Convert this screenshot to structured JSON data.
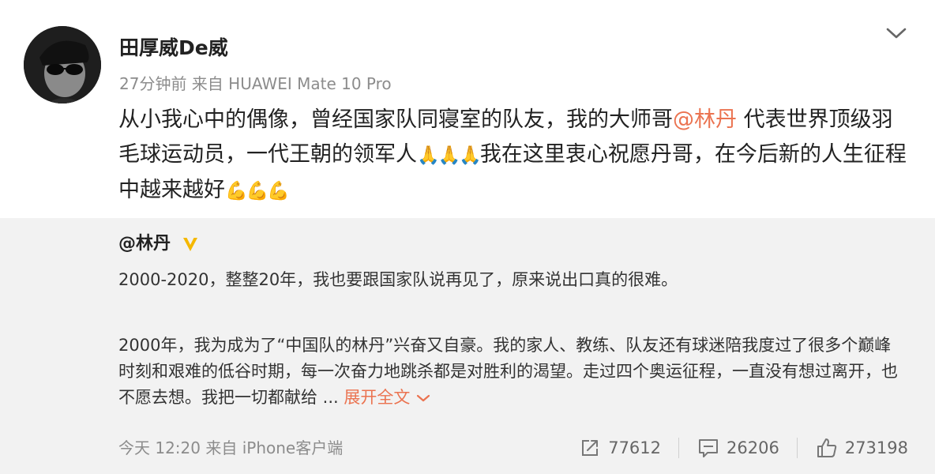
{
  "post": {
    "author": "田厚威De威",
    "meta": "27分钟前 来自 HUAWEI Mate 10 Pro",
    "text_part1": "从小我心中的偶像，曾经国家队同寝室的队友，我的大师哥",
    "mention": "@林丹",
    "text_part2": " 代表世界顶级羽毛球运动员，一代王朝的领军人",
    "emoji1": "🙏🙏🙏",
    "text_part3": "我在这里衷心祝愿丹哥，在今后新的人生征程中越来越好",
    "emoji2": "💪💪💪"
  },
  "repost": {
    "author": "@林丹",
    "paragraph1": "2000-2020，整整20年，我也要跟国家队说再见了，原来说出口真的很难。",
    "paragraph2": "2000年，我为成为了“中国队的林丹”兴奋又自豪。我的家人、教练、队友还有球迷陪我度过了很多个巅峰时刻和艰难的低谷时期，每一次奋力地跳杀都是对胜利的渴望。走过四个奥运征程，一直没有想过离开，也不愿去想。我把一切都献给 ...",
    "expand_label": "展开全文",
    "footer": "今天 12:20 来自 iPhone客户端",
    "reposts": "77612",
    "comments": "26206",
    "likes": "273198"
  },
  "colors": {
    "accent": "#eb7350",
    "verified": "#f5b800",
    "repost_bg": "#f2f2f2"
  },
  "icons": {
    "avatar": "avatar",
    "menu": "chevron-down-icon",
    "verified": "verified-badge-icon",
    "expand": "chevron-down-icon",
    "repost": "share-icon",
    "comment": "comment-icon",
    "like": "thumbs-up-icon"
  }
}
